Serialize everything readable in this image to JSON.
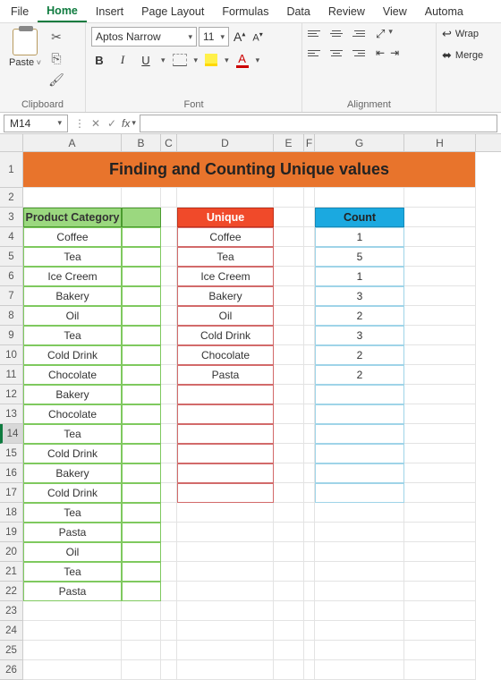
{
  "menu": {
    "items": [
      "File",
      "Home",
      "Insert",
      "Page Layout",
      "Formulas",
      "Data",
      "Review",
      "View",
      "Automa"
    ],
    "active": "Home"
  },
  "ribbon": {
    "clipboard": {
      "label": "Clipboard",
      "paste": "Paste"
    },
    "font": {
      "label": "Font",
      "name": "Aptos Narrow",
      "size": "11",
      "increase": "A",
      "decrease": "A",
      "bold": "B",
      "italic": "I",
      "underline": "U",
      "color_letter": "A"
    },
    "alignment": {
      "label": "Alignment",
      "wrap": "Wrap",
      "merge": "Merge"
    }
  },
  "namebox": "M14",
  "cols": [
    "A",
    "B",
    "C",
    "D",
    "E",
    "F",
    "G",
    "H"
  ],
  "rows": [
    "1",
    "2",
    "3",
    "4",
    "5",
    "6",
    "7",
    "8",
    "9",
    "10",
    "11",
    "12",
    "13",
    "14",
    "15",
    "16",
    "17",
    "18",
    "19",
    "20",
    "21",
    "22",
    "23",
    "24",
    "25",
    "26"
  ],
  "selected_row": "14",
  "title": "Finding and Counting Unique values",
  "headers": {
    "category": "Product Category",
    "unique": "Unique",
    "count": "Count"
  },
  "category": [
    "Coffee",
    "Tea",
    "Ice Creem",
    "Bakery",
    "Oil",
    "Tea",
    "Cold Drink",
    "Chocolate",
    "Bakery",
    "Chocolate",
    "Tea",
    "Cold Drink",
    "Bakery",
    "Cold Drink",
    "Tea",
    "Pasta",
    "Oil",
    "Tea",
    "Pasta"
  ],
  "unique": [
    "Coffee",
    "Tea",
    "Ice Creem",
    "Bakery",
    "Oil",
    "Cold Drink",
    "Chocolate",
    "Pasta"
  ],
  "count": [
    "1",
    "5",
    "1",
    "3",
    "2",
    "3",
    "2",
    "2"
  ],
  "unique_rows": 14,
  "count_rows": 14,
  "chart_data": {
    "type": "table",
    "title": "Finding and Counting Unique values",
    "columns": [
      "Product Category",
      "Unique",
      "Count"
    ],
    "category": [
      "Coffee",
      "Tea",
      "Ice Creem",
      "Bakery",
      "Oil",
      "Tea",
      "Cold Drink",
      "Chocolate",
      "Bakery",
      "Chocolate",
      "Tea",
      "Cold Drink",
      "Bakery",
      "Cold Drink",
      "Tea",
      "Pasta",
      "Oil",
      "Tea",
      "Pasta"
    ],
    "unique": [
      "Coffee",
      "Tea",
      "Ice Creem",
      "Bakery",
      "Oil",
      "Cold Drink",
      "Chocolate",
      "Pasta"
    ],
    "count": [
      1,
      5,
      1,
      3,
      2,
      3,
      2,
      2
    ]
  }
}
